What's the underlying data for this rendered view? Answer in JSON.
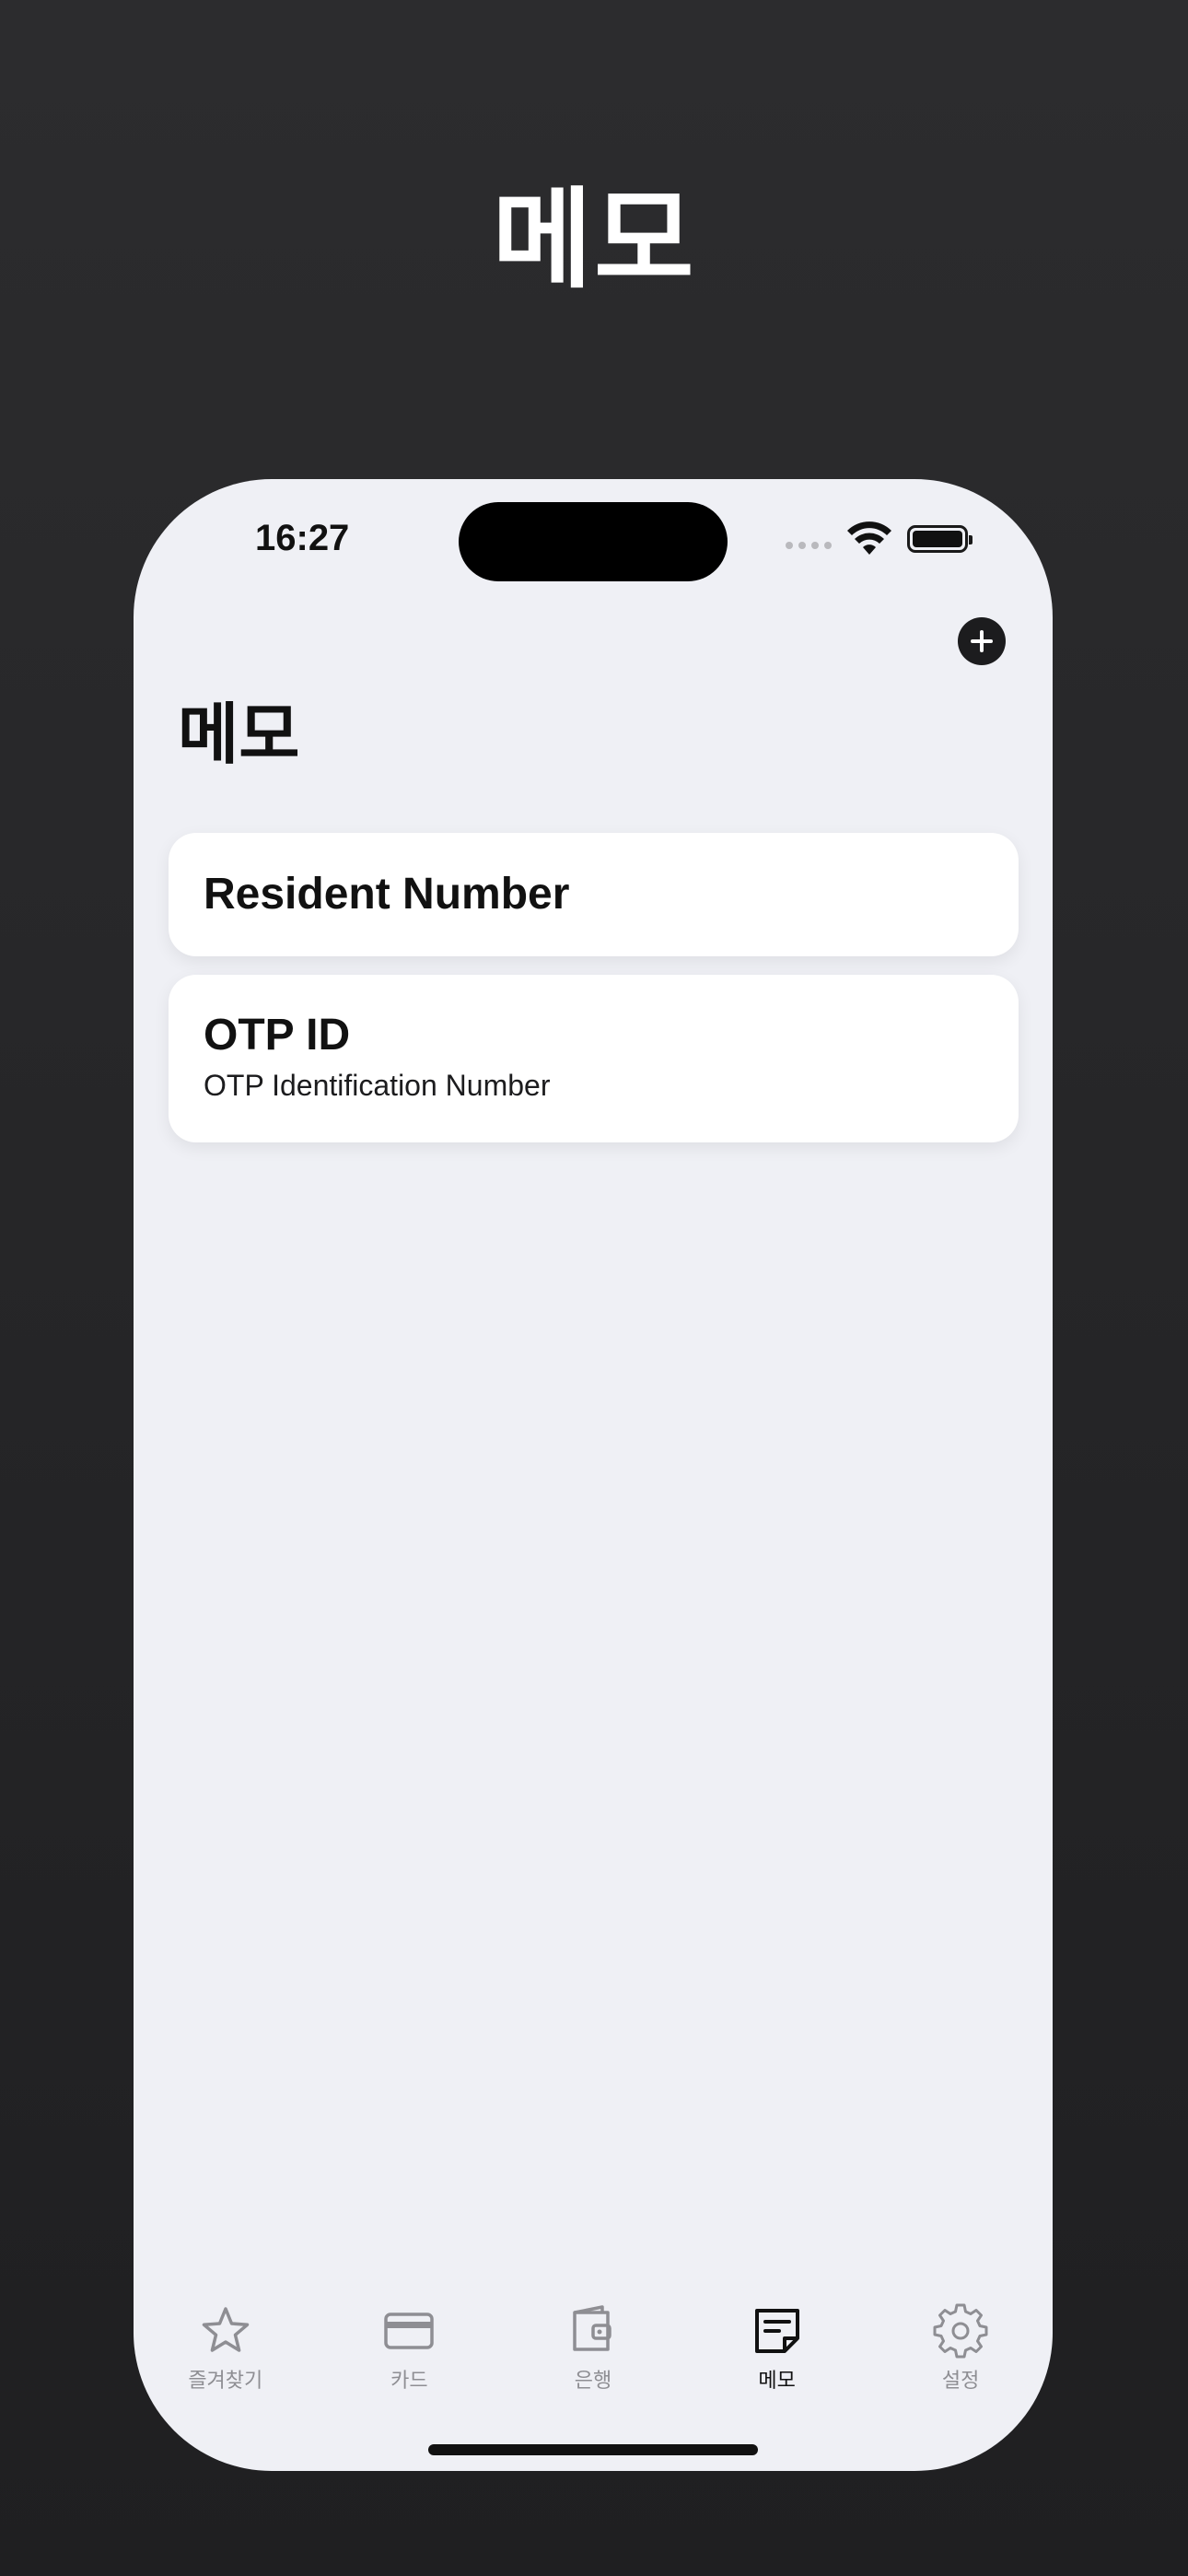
{
  "hero": {
    "title": "메모"
  },
  "status_bar": {
    "time": "16:27"
  },
  "header": {
    "title": "메모",
    "add_icon": "plus-circle-icon"
  },
  "memos": [
    {
      "title": "Resident Number",
      "subtitle": ""
    },
    {
      "title": "OTP ID",
      "subtitle": "OTP Identification Number"
    }
  ],
  "tabs": [
    {
      "label": "즐겨찾기",
      "icon": "star-icon",
      "active": false
    },
    {
      "label": "카드",
      "icon": "credit-card-icon",
      "active": false
    },
    {
      "label": "은행",
      "icon": "wallet-icon",
      "active": false
    },
    {
      "label": "메모",
      "icon": "note-icon",
      "active": true
    },
    {
      "label": "설정",
      "icon": "gear-icon",
      "active": false
    }
  ],
  "colors": {
    "background": "#2c2c2e",
    "screen": "#eff0f5",
    "card": "#ffffff",
    "active_tab": "#111111",
    "inactive_tab": "#8e8e93"
  }
}
